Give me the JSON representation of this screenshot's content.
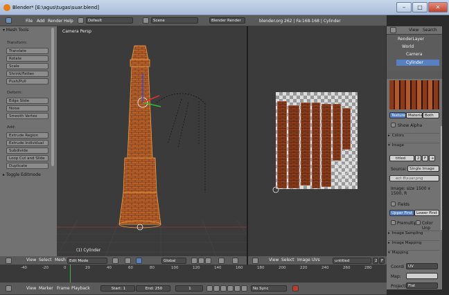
{
  "window": {
    "title": "Blender* [E:\\agus\\tugas\\suar.blend]",
    "minimize": "–",
    "maximize": "□",
    "close": "✕"
  },
  "top_menu": {
    "items": [
      "File",
      "Add",
      "Render",
      "Help"
    ],
    "layout": "Default",
    "scene": "Scene",
    "engine": "Blender Render",
    "stats": "blender.org 262 | Fa:168-168 | Cylinder"
  },
  "outliner": {
    "view": "View",
    "search": "Search",
    "all": "All S",
    "items": [
      "RenderLayer",
      "World",
      "Camera",
      "Cylinder"
    ]
  },
  "tool_shelf": {
    "title": "Mesh Tools",
    "sections": [
      {
        "label": "Transform:",
        "buttons": [
          "Translate",
          "Rotate",
          "Scale",
          "Shrink/Fatten",
          "Push/Pull"
        ]
      },
      {
        "label": "Deform:",
        "buttons": [
          "Edge Slide",
          "Noise",
          "Smooth Vertex"
        ]
      },
      {
        "label": "Add:",
        "buttons": [
          "Extrude Region",
          "Extrude Individual",
          "Subdivide",
          "Loop Cut and Slide",
          "Duplicate"
        ]
      }
    ],
    "toggle": "Toggle Editmode"
  },
  "viewport": {
    "label": "Camera Persp",
    "object": "(1) Cylinder"
  },
  "view3d_header": {
    "view": "View",
    "select": "Select",
    "mesh": "Mesh",
    "mode": "Edit Mode",
    "orientation": "Global"
  },
  "uv_header": {
    "view": "View",
    "select": "Select",
    "image": "Image",
    "uvs": "UVs",
    "image_name": "untitled",
    "users": "2",
    "f": "F"
  },
  "properties": {
    "tabs": [
      "Texture",
      "Material",
      "Both"
    ],
    "show_alpha": "Show Alpha",
    "colors": "Colors",
    "image": "Image",
    "image_name": "titled",
    "image_users": "2",
    "image_f": "F",
    "source_label": "Source:",
    "source": "Single Image",
    "path": "ect 8\\suar.png",
    "size": "Image: size 1500 x 1500, R",
    "fields": "Fields",
    "upper_first": "Upper First",
    "lower_first": "Lower First",
    "premultiply": "Premultip",
    "color_unp": "Color Unp",
    "sections": [
      "Image Sampling",
      "Image Mapping",
      "Mapping"
    ],
    "coords_label": "Coordi",
    "coords": "UV",
    "map_label": "Map:",
    "projection_label": "Projecti",
    "projection": "Flat"
  },
  "timeline": {
    "ticks": [
      "-40",
      "-20",
      "0",
      "20",
      "40",
      "60",
      "80",
      "100",
      "120",
      "140",
      "160",
      "180",
      "200",
      "220",
      "240",
      "260",
      "280"
    ]
  },
  "timeline_header": {
    "view": "View",
    "marker": "Marker",
    "frame": "Frame",
    "playback": "Playback",
    "start": "Start: 1",
    "end": "End: 250",
    "current": "1",
    "sync": "No Sync"
  },
  "colors": {
    "accent": "#e87d0d",
    "selected": "#5680c2",
    "bg": "#3b3b3b"
  }
}
